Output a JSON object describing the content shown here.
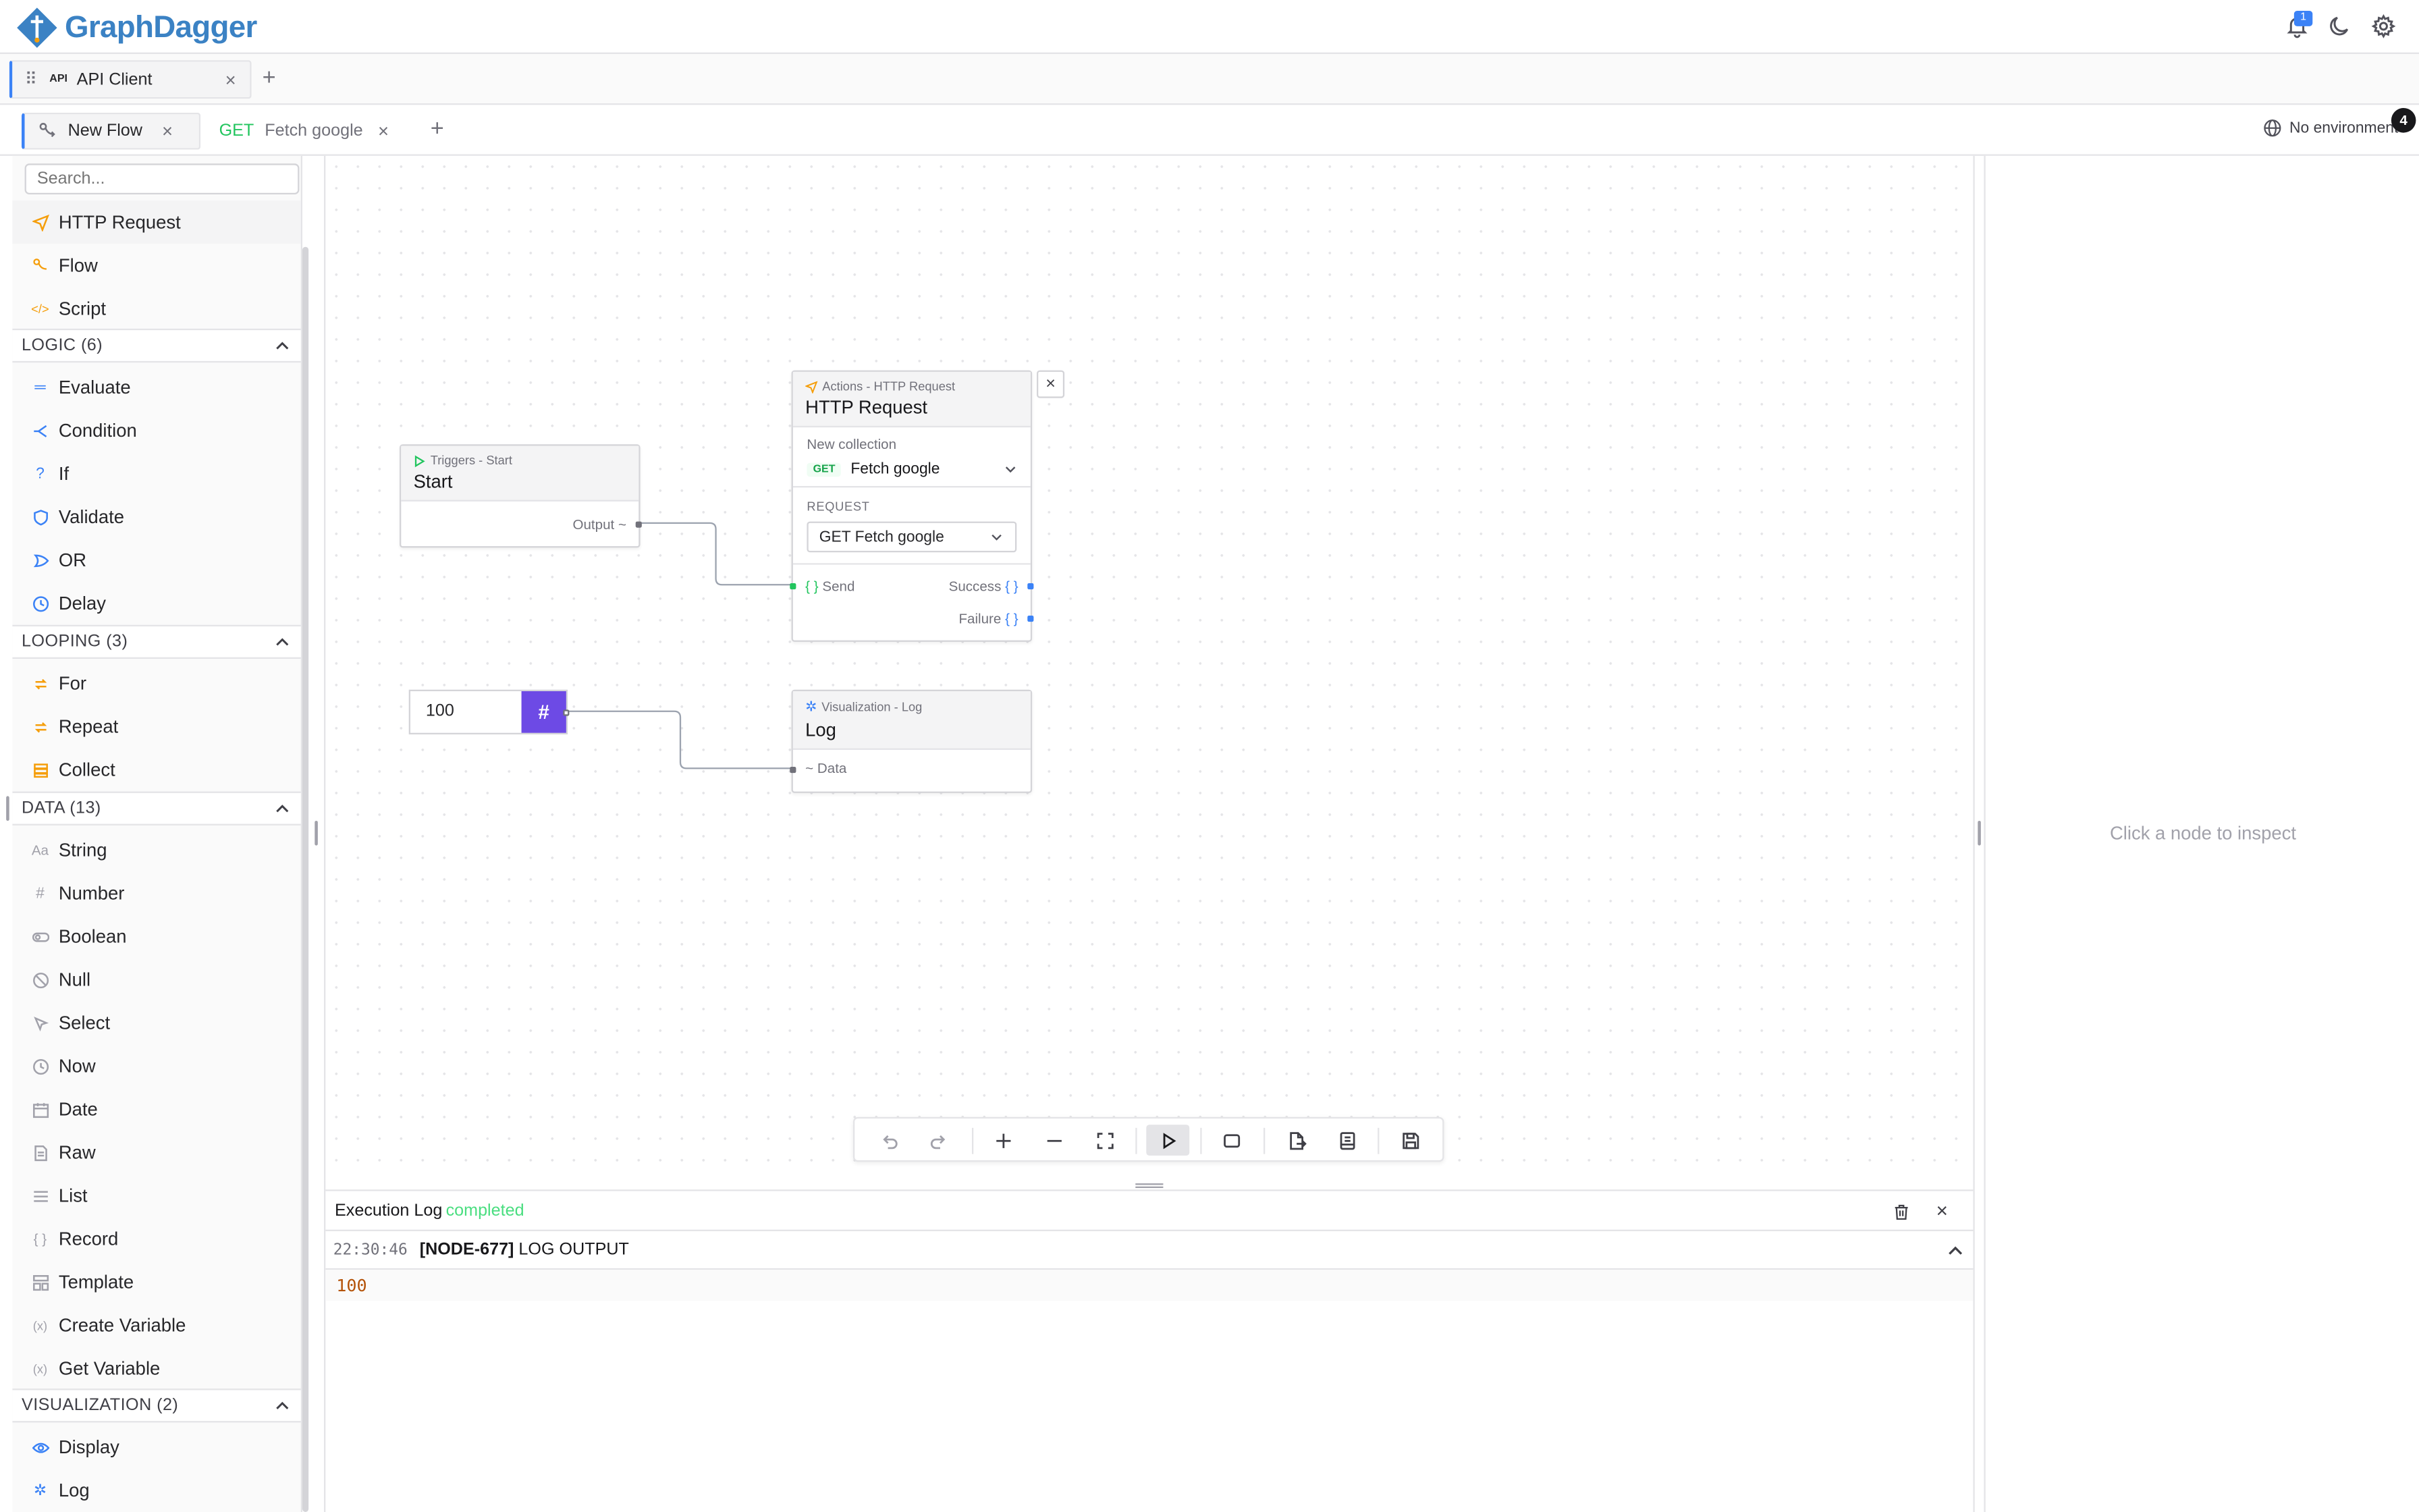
{
  "header": {
    "brand": "GraphDagger",
    "notification_count": "1",
    "colors": {
      "brand": "#3b82c4",
      "accent": "#3b82f6"
    }
  },
  "app_tabs": {
    "items": [
      {
        "icon": "API",
        "label": "API Client"
      }
    ]
  },
  "flow_tabs": {
    "items": [
      {
        "label": "New Flow"
      },
      {
        "method": "GET",
        "label": "Fetch google"
      }
    ]
  },
  "environment": {
    "label": "No environment",
    "badge": "4"
  },
  "sidebar": {
    "search_placeholder": "Search...",
    "top_items": [
      "HTTP Request",
      "Flow",
      "Script"
    ],
    "sections": [
      {
        "title": "LOGIC (6)",
        "items": [
          "Evaluate",
          "Condition",
          "If",
          "Validate",
          "OR",
          "Delay"
        ]
      },
      {
        "title": "LOOPING (3)",
        "items": [
          "For",
          "Repeat",
          "Collect"
        ]
      },
      {
        "title": "DATA (13)",
        "items": [
          "String",
          "Number",
          "Boolean",
          "Null",
          "Select",
          "Now",
          "Date",
          "Raw",
          "List",
          "Record",
          "Template",
          "Create Variable",
          "Get Variable"
        ]
      },
      {
        "title": "VISUALIZATION (2)",
        "items": [
          "Display",
          "Log"
        ]
      }
    ]
  },
  "canvas": {
    "start_node": {
      "category": "Triggers - Start",
      "title": "Start",
      "output": "Output"
    },
    "http_node": {
      "category": "Actions - HTTP Request",
      "title": "HTTP Request",
      "collection_label": "New collection",
      "method": "GET",
      "selected": "Fetch google",
      "request_label": "REQUEST",
      "request_value": "GET Fetch google",
      "input": "Send",
      "success": "Success",
      "failure": "Failure"
    },
    "number_node": {
      "value": "100",
      "symbol": "#"
    },
    "log_node": {
      "category": "Visualization - Log",
      "title": "Log",
      "input": "Data"
    }
  },
  "inspector": {
    "hint": "Click a node to inspect"
  },
  "log_panel": {
    "title": "Execution Log",
    "status": "completed",
    "entries": [
      {
        "time": "22:30:46",
        "node": "[NODE-677]",
        "label": "LOG OUTPUT",
        "value": "100"
      }
    ]
  }
}
